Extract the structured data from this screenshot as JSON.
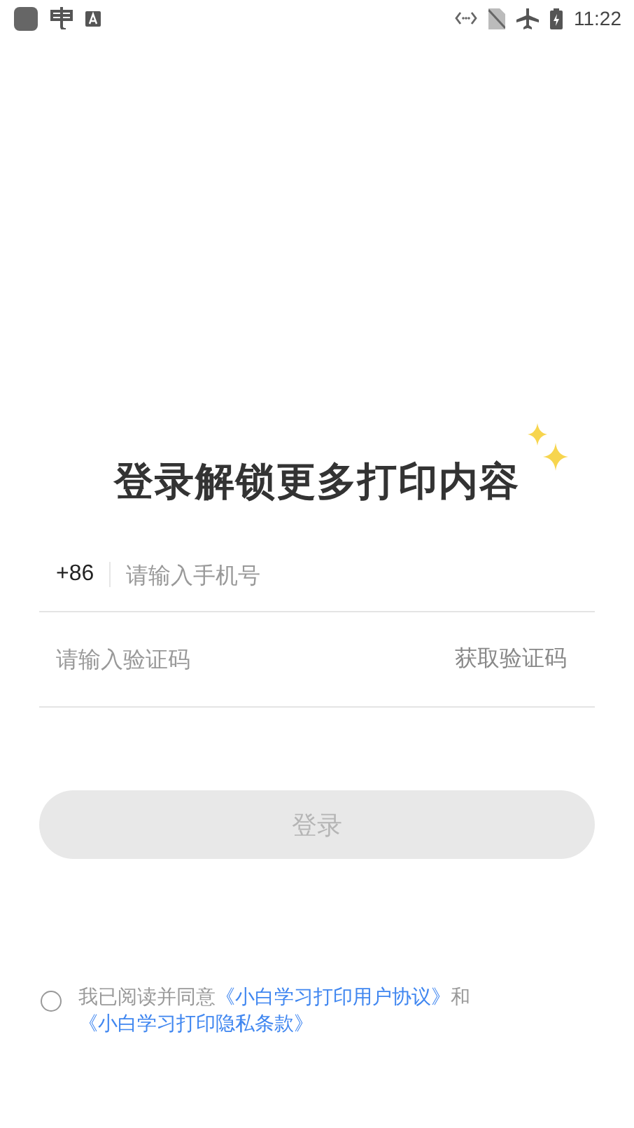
{
  "status_bar": {
    "time": "11:22"
  },
  "title": "登录解锁更多打印内容",
  "phone": {
    "country_code": "+86",
    "placeholder": "请输入手机号"
  },
  "code": {
    "placeholder": "请输入验证码",
    "get_code": "获取验证码"
  },
  "login_button": {
    "label": "登录",
    "disabled": true
  },
  "agreement": {
    "checked": false,
    "parts": [
      {
        "kind": "text",
        "text": "我已阅读并同意"
      },
      {
        "kind": "link",
        "text": "《小白学习打印用户协议》"
      },
      {
        "kind": "text",
        "text": "和"
      },
      {
        "kind": "link",
        "text": "《小白学习打印隐私条款》"
      }
    ]
  }
}
